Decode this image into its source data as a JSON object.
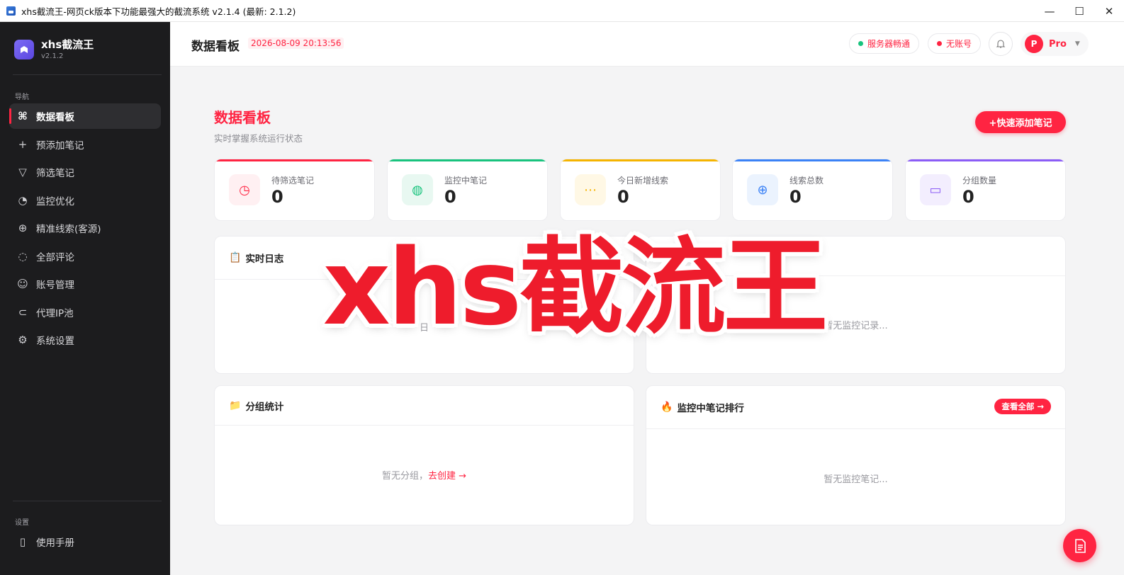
{
  "window": {
    "title": "xhs截流王-网页ck版本下功能最强大的截流系统 v2.1.4 (最新: 2.1.2)",
    "minimize": "—",
    "maximize": "☐",
    "close": "✕"
  },
  "sidebar": {
    "brand_name": "xhs截流王",
    "brand_version": "v2.1.2",
    "nav_section": "导航",
    "items": [
      {
        "label": "数据看板",
        "icon": "chart-board-icon",
        "glyph": "⌘",
        "active": true
      },
      {
        "label": "预添加笔记",
        "icon": "plus-icon",
        "glyph": "+"
      },
      {
        "label": "筛选笔记",
        "icon": "filter-icon",
        "glyph": "▽"
      },
      {
        "label": "监控优化",
        "icon": "gauge-icon",
        "glyph": "◔"
      },
      {
        "label": "精准线索(客源)",
        "icon": "crosshair-icon",
        "glyph": "⊕"
      },
      {
        "label": "全部评论",
        "icon": "comment-icon",
        "glyph": "◌"
      },
      {
        "label": "账号管理",
        "icon": "user-icon",
        "glyph": "☺"
      },
      {
        "label": "代理IP池",
        "icon": "link-icon",
        "glyph": "⊂"
      },
      {
        "label": "系统设置",
        "icon": "gear-icon",
        "glyph": "⚙"
      }
    ],
    "settings_section": "设置",
    "settings_items": [
      {
        "label": "使用手册",
        "icon": "book-icon",
        "glyph": "▯"
      }
    ]
  },
  "header": {
    "title": "数据看板",
    "datetime": "2026-08-09 20:13:56",
    "server_status": "服务器畅通",
    "account_status": "无账号",
    "user_initial": "P",
    "plan": "Pro"
  },
  "main": {
    "heading": "数据看板",
    "subheading": "实时掌握系统运行状态",
    "quick_add": "+快速添加笔记",
    "stats": [
      {
        "label": "待筛选笔记",
        "value": "0",
        "color": "#ff2442",
        "tint": "#fff0f2",
        "icon": "clock-icon",
        "glyph": "◷"
      },
      {
        "label": "监控中笔记",
        "value": "0",
        "color": "#18c37d",
        "tint": "#e8f8f1",
        "icon": "gauge-icon",
        "glyph": "◍"
      },
      {
        "label": "今日新增线索",
        "value": "0",
        "color": "#f5b400",
        "tint": "#fff8e5",
        "icon": "chat-icon",
        "glyph": "⋯"
      },
      {
        "label": "线索总数",
        "value": "0",
        "color": "#3b82f6",
        "tint": "#ebf3fe",
        "icon": "target-icon",
        "glyph": "⊕"
      },
      {
        "label": "分组数量",
        "value": "0",
        "color": "#8b5cf6",
        "tint": "#f3eefe",
        "icon": "folder-icon",
        "glyph": "▭"
      }
    ],
    "panels": {
      "log": {
        "title": "实时日志",
        "empty_fragment": "日"
      },
      "monitor_records": {
        "title_fragment": "录",
        "empty": "暂无监控记录..."
      },
      "groups": {
        "title": "分组统计",
        "empty": "暂无分组，",
        "create_link": "去创建 →"
      },
      "ranking": {
        "title": "监控中笔记排行",
        "view_all": "查看全部 →",
        "empty": "暂无监控笔记..."
      }
    }
  },
  "watermark": "xhs截流王",
  "colors": {
    "accent": "#ff2442",
    "sidebar_bg": "#1c1c1e",
    "success": "#18c37d"
  }
}
